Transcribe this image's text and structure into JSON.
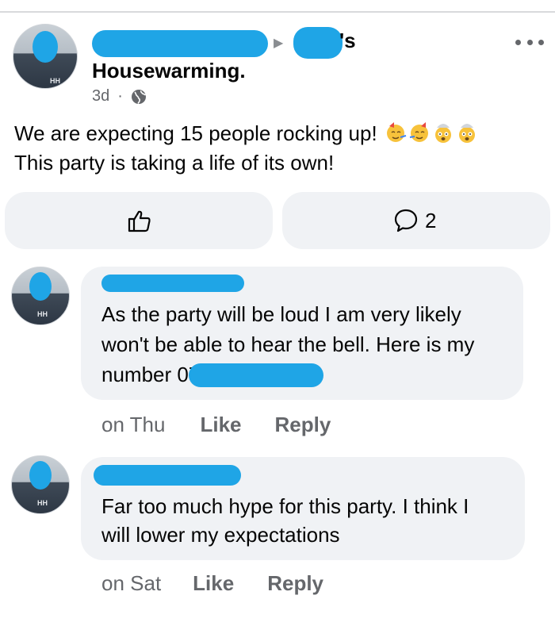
{
  "post": {
    "author_suffix": "'s",
    "title": "Housewarming.",
    "time": "3d",
    "separator": "·",
    "text_line1": "We are expecting 15 people rocking up!",
    "text_line2": "This party is taking a life of its own!",
    "avatar_logo": "HH",
    "emojis": [
      "partying-face-emoji",
      "partying-face-emoji",
      "exploding-head-emoji",
      "exploding-head-emoji"
    ]
  },
  "actions": {
    "comment_count": "2"
  },
  "comments": [
    {
      "line1": "As the party will be loud I am very likely",
      "line2": "won't be able to hear the bell. Here is my",
      "line3": "number 07",
      "time": "on Thu",
      "like": "Like",
      "reply": "Reply",
      "avatar_logo": "HH"
    },
    {
      "line1": "Far too much hype for this party. I think I",
      "line2": "will lower my expectations",
      "time": "on Sat",
      "like": "Like",
      "reply": "Reply",
      "avatar_logo": "HH"
    }
  ],
  "colors": {
    "redaction": "#1fa5e6",
    "bubble": "#f0f2f5",
    "secondary_text": "#65676b"
  }
}
